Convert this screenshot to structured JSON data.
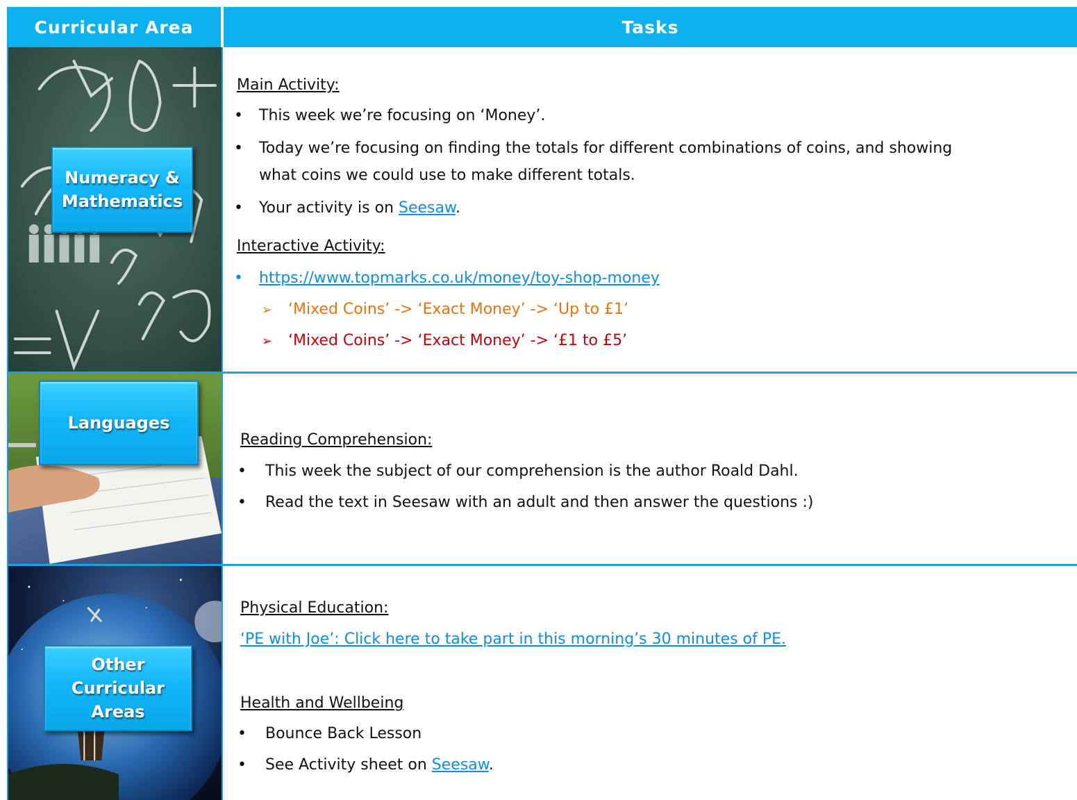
{
  "header": {
    "left": "Curricular Area",
    "right": "Tasks"
  },
  "rows": {
    "maths": {
      "label_line1": "Numeracy &",
      "label_line2": "Mathematics",
      "main_heading": "Main Activity:",
      "bullet1": "This week we’re focusing on ‘Money’.",
      "bullet2_line1": "Today we’re focusing on finding the totals for different combinations of coins, and showing",
      "bullet2_line2": "what coins we could use to make different totals.",
      "bullet3_prefix": "Your activity is on ",
      "bullet3_link": "Seesaw",
      "bullet3_suffix": ".",
      "interactive_heading": "Interactive Activity:",
      "interactive_link": "https://www.topmarks.co.uk/money/toy-shop-money",
      "sub1": "‘Mixed Coins’ -> ‘Exact Money’ -> ‘Up to £1’",
      "sub2": "‘Mixed Coins’ -> ‘Exact Money’ -> ‘£1 to £5’"
    },
    "languages": {
      "label": "Languages",
      "heading": "Reading Comprehension:",
      "bullet1": "This week the subject of our comprehension is the author Roald Dahl.",
      "bullet2": "Read the text in Seesaw with an adult and then answer the questions :)"
    },
    "other": {
      "label_line1": "Other",
      "label_line2": "Curricular",
      "label_line3": "Areas",
      "pe_heading": "Physical Education:",
      "pe_link": "‘PE with Joe’: Click here to take part in this morning’s 30 minutes of PE.",
      "hw_heading": "Health and Wellbeing",
      "bullet1": "Bounce Back Lesson",
      "bullet2_prefix": "See Activity sheet on ",
      "bullet2_link": "Seesaw",
      "bullet2_suffix": "."
    }
  },
  "colors": {
    "header_bg": "#0fb0f0",
    "link": "#0a8ee8",
    "orange_text": "#e8730c",
    "red_text": "#c8000a"
  }
}
